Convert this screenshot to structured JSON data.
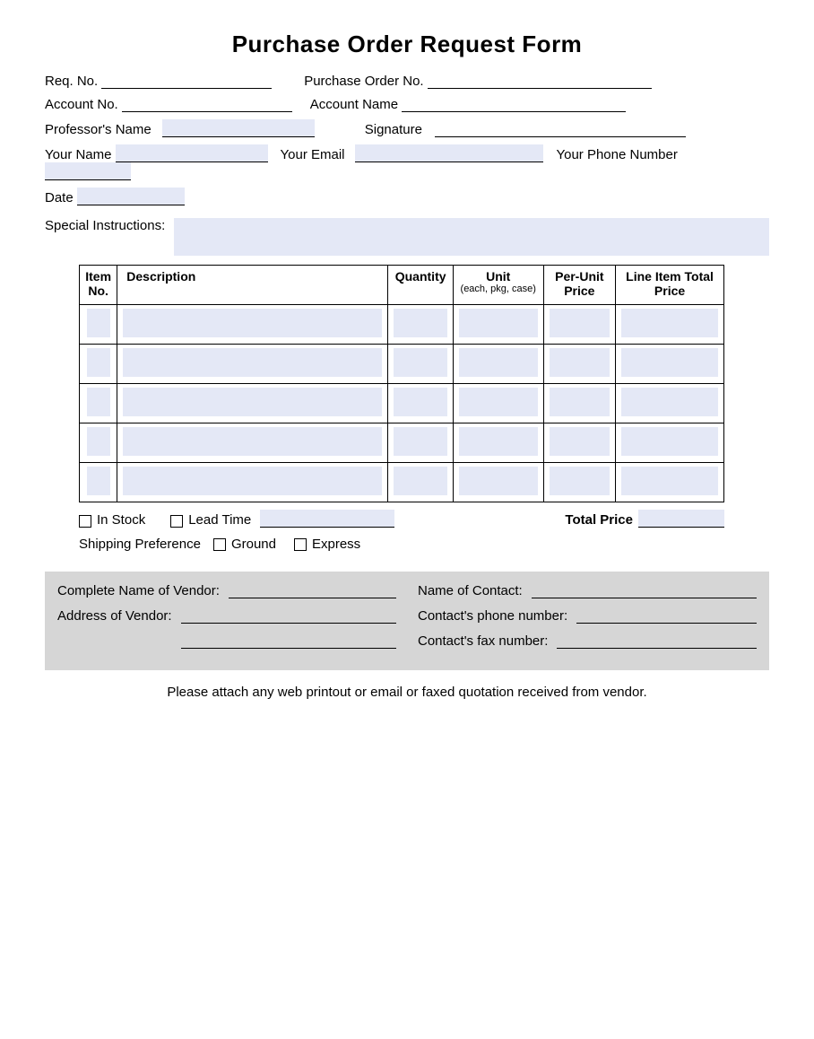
{
  "title": "Purchase Order Request Form",
  "labels": {
    "reqNo": "Req. No.",
    "poNo": "Purchase Order No.",
    "acctNo": "Account No.",
    "acctName": "Account Name",
    "profName": "Professor's Name",
    "signature": "Signature",
    "yourName": "Your Name",
    "yourEmail": "Your Email",
    "yourPhone": "Your Phone Number",
    "date": "Date",
    "specialInstr": "Special Instructions:",
    "inStock": "In Stock",
    "leadTime": "Lead Time",
    "totalPrice": "Total Price",
    "shipPref": "Shipping Preference",
    "ground": "Ground",
    "express": "Express"
  },
  "table": {
    "headers": {
      "itemNo": "Item No.",
      "description": "Description",
      "quantity": "Quantity",
      "unit": "Unit",
      "unitSub": "(each, pkg, case)",
      "perUnit": "Per-Unit Price",
      "lineTotal": "Line Item Total Price"
    },
    "rowCount": 5
  },
  "vendor": {
    "vendorName": "Complete Name of Vendor:",
    "vendorAddr": "Address of Vendor:",
    "contactName": "Name of Contact:",
    "contactPhone": "Contact's phone number:",
    "contactFax": "Contact's fax number:"
  },
  "footnote": "Please attach any web printout or email or faxed quotation received from vendor."
}
